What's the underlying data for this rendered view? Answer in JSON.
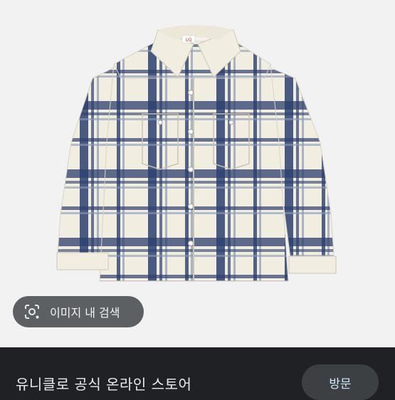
{
  "image_search_chip": {
    "label": "이미지 내 검색",
    "icon": "lens-search-icon"
  },
  "result": {
    "store_title": "유니클로 공식 온라인 스토어",
    "visit_label": "방문"
  },
  "product_image": {
    "brand_tag_text": "UQ",
    "colors": {
      "background": "#f2f2f2",
      "fabric": "#f1ede0",
      "navy": "#2c3f6e"
    }
  }
}
